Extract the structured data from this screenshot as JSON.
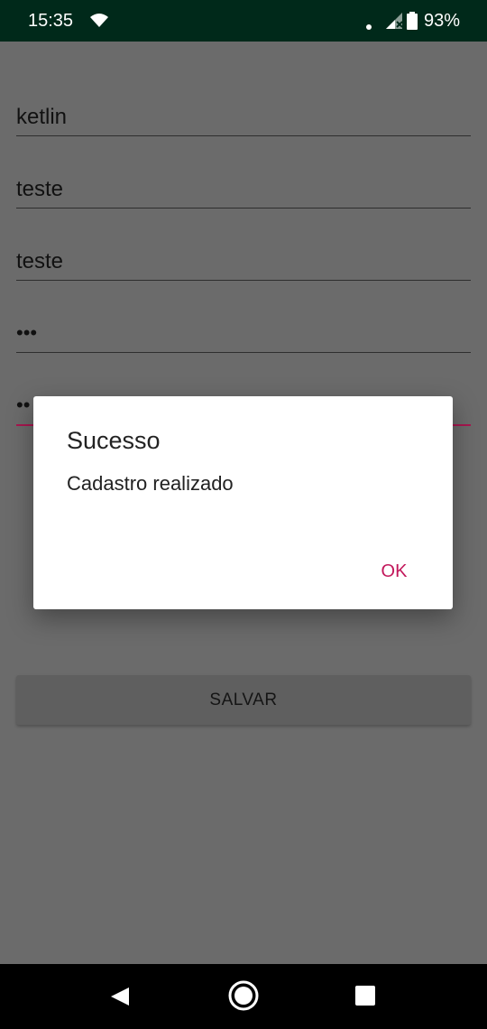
{
  "status_bar": {
    "time": "15:35",
    "battery_percent": "93%",
    "icons": [
      "wifi-icon",
      "notification-dot-icon",
      "signal-icon",
      "battery-icon"
    ]
  },
  "form": {
    "fields": [
      {
        "value": "ketlin"
      },
      {
        "value": "teste"
      },
      {
        "value": "teste"
      },
      {
        "value": "•••",
        "masked": true
      },
      {
        "value": "••",
        "masked": true,
        "focused": true
      }
    ],
    "save_label": "SALVAR"
  },
  "dialog": {
    "title": "Sucesso",
    "message": "Cadastro realizado",
    "ok_label": "OK"
  },
  "nav_bar": {
    "icons": [
      "back-icon",
      "home-icon",
      "recents-icon"
    ]
  },
  "colors": {
    "status_bar": "#00291a",
    "scrim_background": "#6b6b6b",
    "accent": "#c2185b",
    "dialog_background": "#ffffff",
    "nav_bar": "#000000"
  }
}
